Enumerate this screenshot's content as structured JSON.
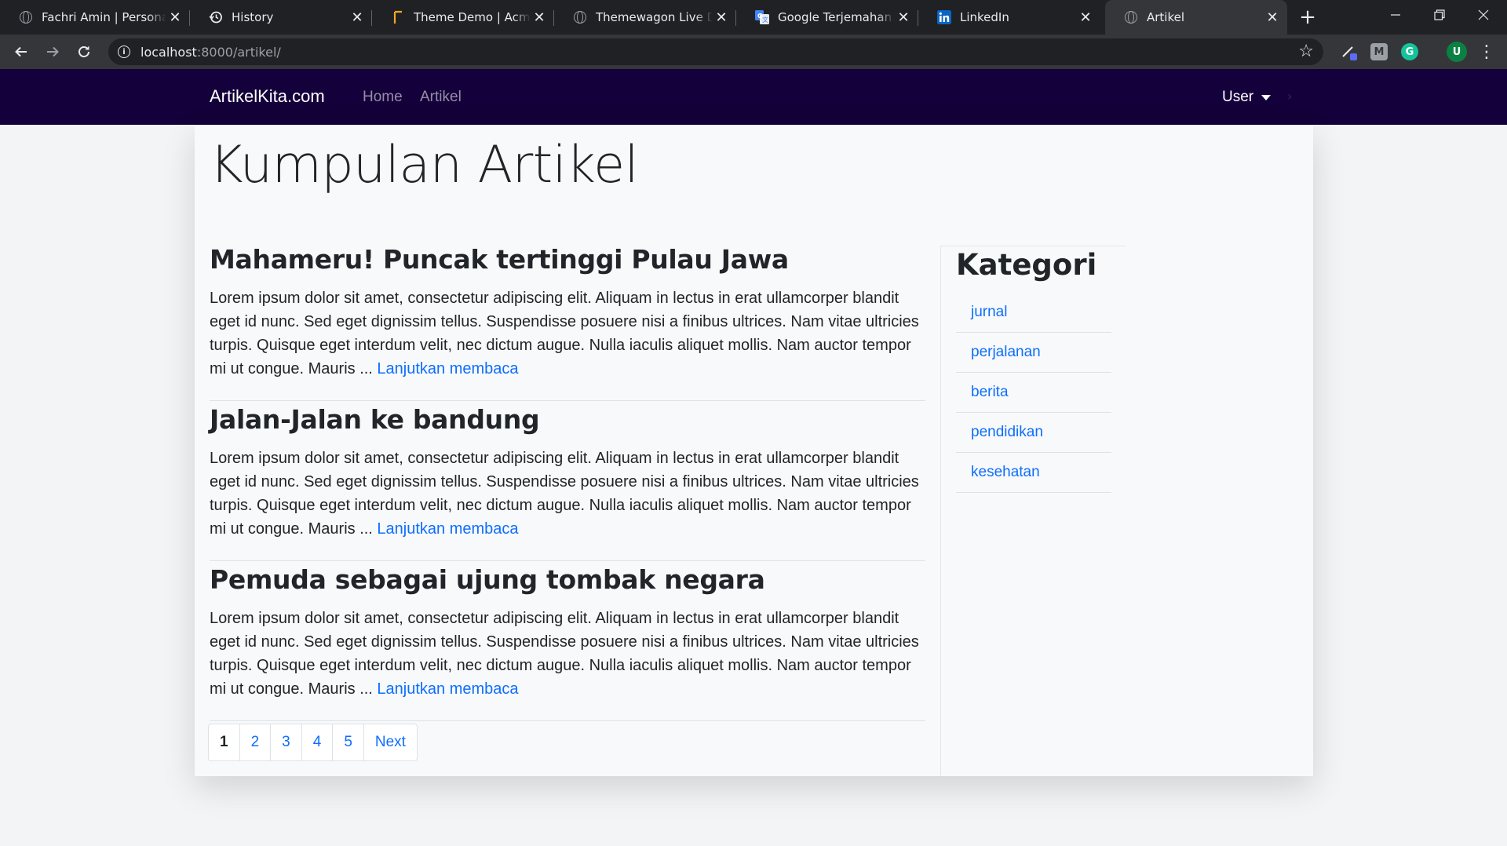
{
  "browser": {
    "tabs": [
      {
        "title": "Fachri Amin | Personal Portfolio",
        "icon": "globe-icon"
      },
      {
        "title": "History",
        "icon": "history-icon"
      },
      {
        "title": "Theme Demo | Acme Themes",
        "icon": "acme-icon"
      },
      {
        "title": "Themewagon Live Demo",
        "icon": "globe-icon"
      },
      {
        "title": "Google Terjemahan",
        "icon": "google-translate-icon"
      },
      {
        "title": "LinkedIn",
        "icon": "linkedin-icon"
      },
      {
        "title": "Artikel",
        "icon": "globe-icon"
      }
    ],
    "close_glyph": "✕",
    "new_tab_glyph": "+",
    "url_host": "localhost",
    "url_path": ":8000/artikel/",
    "extensions": [
      "M",
      "G",
      "U"
    ]
  },
  "navbar": {
    "brand": "ArtikelKita.com",
    "links": [
      "Home",
      "Artikel"
    ],
    "user_menu": "User"
  },
  "main": {
    "title": "Kumpulan Artikel",
    "articles": [
      {
        "title": "Mahameru! Puncak tertinggi Pulau Jawa",
        "excerpt": "Lorem ipsum dolor sit amet, consectetur adipiscing elit. Aliquam in lectus in erat ullamcorper blandit eget id nunc. Sed eget dignissim tellus. Suspendisse posuere nisi a finibus ultrices. Nam vitae ultricies turpis. Quisque eget interdum velit, nec dictum augue. Nulla iaculis aliquet mollis. Nam auctor tempor mi ut congue. Mauris ... ",
        "read_more": "Lanjutkan membaca"
      },
      {
        "title": "Jalan-Jalan ke bandung",
        "excerpt": "Lorem ipsum dolor sit amet, consectetur adipiscing elit. Aliquam in lectus in erat ullamcorper blandit eget id nunc. Sed eget dignissim tellus. Suspendisse posuere nisi a finibus ultrices. Nam vitae ultricies turpis. Quisque eget interdum velit, nec dictum augue. Nulla iaculis aliquet mollis. Nam auctor tempor mi ut congue. Mauris ... ",
        "read_more": "Lanjutkan membaca"
      },
      {
        "title": "Pemuda sebagai ujung tombak negara",
        "excerpt": "Lorem ipsum dolor sit amet, consectetur adipiscing elit. Aliquam in lectus in erat ullamcorper blandit eget id nunc. Sed eget dignissim tellus. Suspendisse posuere nisi a finibus ultrices. Nam vitae ultricies turpis. Quisque eget interdum velit, nec dictum augue. Nulla iaculis aliquet mollis. Nam auctor tempor mi ut congue. Mauris ... ",
        "read_more": "Lanjutkan membaca"
      }
    ],
    "pagination": [
      "1",
      "2",
      "3",
      "4",
      "5",
      "Next"
    ]
  },
  "sidebar": {
    "title": "Kategori",
    "categories": [
      "jurnal",
      "perjalanan",
      "berita",
      "pendidikan",
      "kesehatan"
    ]
  },
  "colors": {
    "navbar_bg": "#14003a",
    "link": "#0d6efd"
  }
}
